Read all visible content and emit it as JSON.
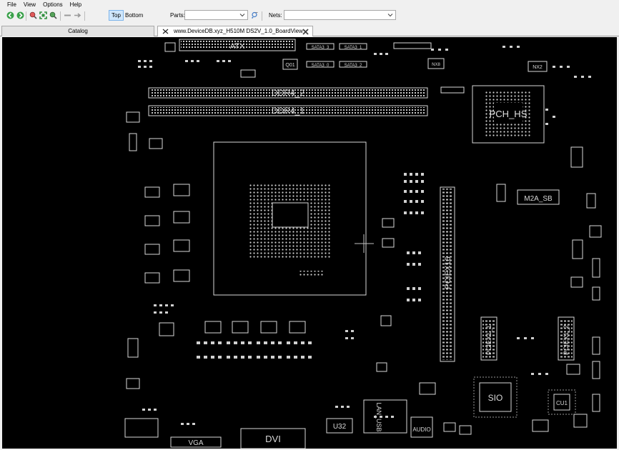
{
  "menu": {
    "items": [
      "File",
      "View",
      "Options",
      "Help"
    ]
  },
  "toolbar": {
    "icons": [
      "back-icon",
      "forward-icon",
      "zoom-in-icon",
      "fit-icon",
      "zoom-out-icon",
      "minus-icon",
      "arrow-right-icon"
    ],
    "side_top": "Top",
    "side_bottom": "Bottom",
    "parts_label": "Parts:",
    "parts_value": "",
    "nets_label": "Nets:",
    "nets_value": ""
  },
  "tabs": {
    "catalog": "Catalog",
    "board": "www.DeviceDB.xyz_H510M DS2V_1.0_BoardView"
  },
  "board": {
    "labels": {
      "atx": "ATX",
      "ddr4_2": "DDR4_2",
      "ddr4_1": "DDR4_1",
      "pch": "PCH_HS",
      "m2a": "M2A_SB",
      "pciex16": "PCIEX16",
      "pciex1_1": "PCIEX1_1",
      "pciex1_2": "PCIEX1_2",
      "sio": "SIO",
      "dvi": "DVI",
      "vga": "VGA",
      "u32": "U32",
      "audio": "AUDIO",
      "lan": "LAN_USB",
      "q01": "Q01",
      "cu1": "CU1",
      "sata0": "SATA3_0",
      "sata1": "SATA3_1",
      "sata2": "SATA3_2",
      "sata3": "SATA3_3",
      "nx2": "NX2",
      "nx8": "NX8"
    },
    "colors": {
      "background": "#000000",
      "outline": "#d8d8d8"
    }
  }
}
